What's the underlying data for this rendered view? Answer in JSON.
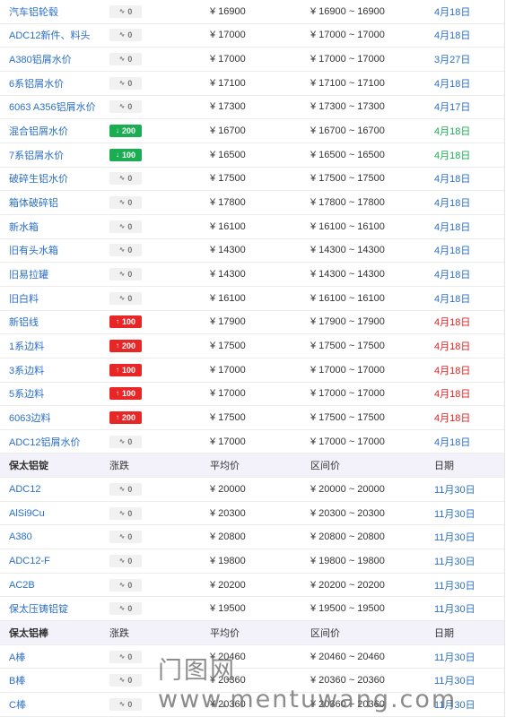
{
  "groups": [
    {
      "header": null,
      "rows": [
        {
          "name": "汽车铝轮毂",
          "dir": "flat",
          "change": "0",
          "avg": "¥ 16900",
          "range": "¥ 16900 ~ 16900",
          "date": "4月18日",
          "date_color": "blue"
        },
        {
          "name": "ADC12新件、料头",
          "dir": "flat",
          "change": "0",
          "avg": "¥ 17000",
          "range": "¥ 17000 ~ 17000",
          "date": "4月18日",
          "date_color": "blue"
        },
        {
          "name": "A380铝屑水价",
          "dir": "flat",
          "change": "0",
          "avg": "¥ 17000",
          "range": "¥ 17000 ~ 17000",
          "date": "3月27日",
          "date_color": "blue"
        },
        {
          "name": "6系铝屑水价",
          "dir": "flat",
          "change": "0",
          "avg": "¥ 17100",
          "range": "¥ 17100 ~ 17100",
          "date": "4月18日",
          "date_color": "blue"
        },
        {
          "name": "6063 A356铝屑水价",
          "dir": "flat",
          "change": "0",
          "avg": "¥ 17300",
          "range": "¥ 17300 ~ 17300",
          "date": "4月17日",
          "date_color": "blue"
        },
        {
          "name": "混合铝屑水价",
          "dir": "down",
          "change": "200",
          "avg": "¥ 16700",
          "range": "¥ 16700 ~ 16700",
          "date": "4月18日",
          "date_color": "green"
        },
        {
          "name": "7系铝屑水价",
          "dir": "down",
          "change": "100",
          "avg": "¥ 16500",
          "range": "¥ 16500 ~ 16500",
          "date": "4月18日",
          "date_color": "green"
        },
        {
          "name": "破碎生铝水价",
          "dir": "flat",
          "change": "0",
          "avg": "¥ 17500",
          "range": "¥ 17500 ~ 17500",
          "date": "4月18日",
          "date_color": "blue"
        },
        {
          "name": "箱体破碎铝",
          "dir": "flat",
          "change": "0",
          "avg": "¥ 17800",
          "range": "¥ 17800 ~ 17800",
          "date": "4月18日",
          "date_color": "blue"
        },
        {
          "name": "新水箱",
          "dir": "flat",
          "change": "0",
          "avg": "¥ 16100",
          "range": "¥ 16100 ~ 16100",
          "date": "4月18日",
          "date_color": "blue"
        },
        {
          "name": "旧有头水箱",
          "dir": "flat",
          "change": "0",
          "avg": "¥ 14300",
          "range": "¥ 14300 ~ 14300",
          "date": "4月18日",
          "date_color": "blue"
        },
        {
          "name": "旧易拉罐",
          "dir": "flat",
          "change": "0",
          "avg": "¥ 14300",
          "range": "¥ 14300 ~ 14300",
          "date": "4月18日",
          "date_color": "blue"
        },
        {
          "name": "旧白料",
          "dir": "flat",
          "change": "0",
          "avg": "¥ 16100",
          "range": "¥ 16100 ~ 16100",
          "date": "4月18日",
          "date_color": "blue"
        },
        {
          "name": "新铝线",
          "dir": "up",
          "change": "100",
          "avg": "¥ 17900",
          "range": "¥ 17900 ~ 17900",
          "date": "4月18日",
          "date_color": "red"
        },
        {
          "name": "1系边料",
          "dir": "up",
          "change": "200",
          "avg": "¥ 17500",
          "range": "¥ 17500 ~ 17500",
          "date": "4月18日",
          "date_color": "red"
        },
        {
          "name": "3系边料",
          "dir": "up",
          "change": "100",
          "avg": "¥ 17000",
          "range": "¥ 17000 ~ 17000",
          "date": "4月18日",
          "date_color": "red"
        },
        {
          "name": "5系边料",
          "dir": "up",
          "change": "100",
          "avg": "¥ 17000",
          "range": "¥ 17000 ~ 17000",
          "date": "4月18日",
          "date_color": "red"
        },
        {
          "name": "6063边料",
          "dir": "up",
          "change": "200",
          "avg": "¥ 17500",
          "range": "¥ 17500 ~ 17500",
          "date": "4月18日",
          "date_color": "red"
        },
        {
          "name": "ADC12铝屑水价",
          "dir": "flat",
          "change": "0",
          "avg": "¥ 17000",
          "range": "¥ 17000 ~ 17000",
          "date": "4月18日",
          "date_color": "blue"
        }
      ]
    },
    {
      "header": {
        "name": "保太铝锭",
        "change": "涨跌",
        "avg": "平均价",
        "range": "区间价",
        "date": "日期"
      },
      "rows": [
        {
          "name": "ADC12",
          "dir": "flat",
          "change": "0",
          "avg": "¥ 20000",
          "range": "¥ 20000 ~ 20000",
          "date": "11月30日",
          "date_color": "blue"
        },
        {
          "name": "AlSi9Cu",
          "dir": "flat",
          "change": "0",
          "avg": "¥ 20300",
          "range": "¥ 20300 ~ 20300",
          "date": "11月30日",
          "date_color": "blue"
        },
        {
          "name": "A380",
          "dir": "flat",
          "change": "0",
          "avg": "¥ 20800",
          "range": "¥ 20800 ~ 20800",
          "date": "11月30日",
          "date_color": "blue"
        },
        {
          "name": "ADC12-F",
          "dir": "flat",
          "change": "0",
          "avg": "¥ 19800",
          "range": "¥ 19800 ~ 19800",
          "date": "11月30日",
          "date_color": "blue"
        },
        {
          "name": "AC2B",
          "dir": "flat",
          "change": "0",
          "avg": "¥ 20200",
          "range": "¥ 20200 ~ 20200",
          "date": "11月30日",
          "date_color": "blue"
        },
        {
          "name": "保太压铸铝锭",
          "dir": "flat",
          "change": "0",
          "avg": "¥ 19500",
          "range": "¥ 19500 ~ 19500",
          "date": "11月30日",
          "date_color": "blue"
        }
      ]
    },
    {
      "header": {
        "name": "保太铝棒",
        "change": "涨跌",
        "avg": "平均价",
        "range": "区间价",
        "date": "日期"
      },
      "rows": [
        {
          "name": "A棒",
          "dir": "flat",
          "change": "0",
          "avg": "¥ 20460",
          "range": "¥ 20460 ~ 20460",
          "date": "11月30日",
          "date_color": "blue"
        },
        {
          "name": "B棒",
          "dir": "flat",
          "change": "0",
          "avg": "¥ 20360",
          "range": "¥ 20360 ~ 20360",
          "date": "11月30日",
          "date_color": "blue"
        },
        {
          "name": "C棒",
          "dir": "flat",
          "change": "0",
          "avg": "¥ 20360",
          "range": "¥ 20360 ~ 20360",
          "date": "11月30日",
          "date_color": "blue"
        }
      ]
    }
  ],
  "icons": {
    "flat": "tilde-icon",
    "up": "arrow-up-icon",
    "down": "arrow-down-icon"
  },
  "colors": {
    "link": "#2b6fc7",
    "up": "#e82626",
    "down": "#1aad52",
    "header_bg": "#f3f2fb"
  },
  "watermark": "门图网 www.mentuwang.com"
}
